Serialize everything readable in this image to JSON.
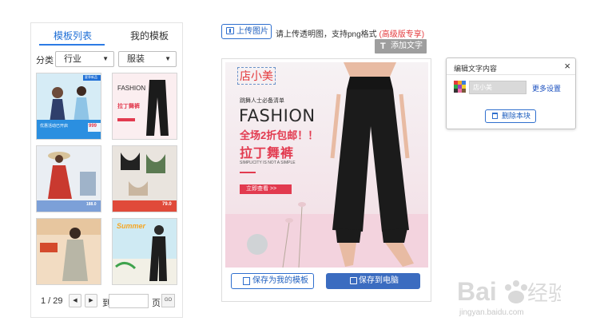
{
  "tabs": [
    {
      "label": "模板列表",
      "active": true
    },
    {
      "label": "我的模板",
      "active": false
    }
  ],
  "filters": {
    "label": "分类",
    "category_value": "行业",
    "subcategory_value": "服装"
  },
  "templates": [
    {
      "name": "template-1",
      "badge": "夏季新品",
      "price": "999",
      "caption": "优惠活动已开启"
    },
    {
      "name": "template-2",
      "headline": "FASHION",
      "title": "拉丁舞裤"
    },
    {
      "name": "template-3",
      "price": "188.0"
    },
    {
      "name": "template-4",
      "price": "79.0"
    },
    {
      "name": "template-5"
    },
    {
      "name": "template-6",
      "headline": "Summer"
    }
  ],
  "pagination": {
    "current_total": "1 / 29",
    "prev": "◀",
    "next": "▶",
    "to_label": "到",
    "page_label": "页",
    "go_label": "GO"
  },
  "toolbar": {
    "upload_label": "上传图片",
    "upload_tip": "请上传透明图，支持png格式",
    "premium_tip": "(高级版专享)",
    "add_text_label": "添加文字"
  },
  "poster": {
    "shop_text": "店小美",
    "sub_text": "跳舞人士必备清单",
    "headline": "FASHION",
    "promo": "全场2折包邮！！",
    "title": "拉丁舞裤",
    "en_line": "SIMPLICITY IS NOT A SIMPLE",
    "cta": "立即查看 >>"
  },
  "actions": {
    "save_template_label": "保存为我的模板",
    "save_pc_label": "保存到电脑"
  },
  "edit_dialog": {
    "title": "编辑文字内容",
    "close": "×",
    "text_value": "店小美",
    "more_settings": "更多设置",
    "delete_label": "删除本块"
  },
  "watermark": {
    "text": "jingyan.baidu.com"
  },
  "colors": {
    "accent_blue": "#2c7be5",
    "promo_red": "#e23a4f",
    "button_blue": "#3b6cc0"
  }
}
